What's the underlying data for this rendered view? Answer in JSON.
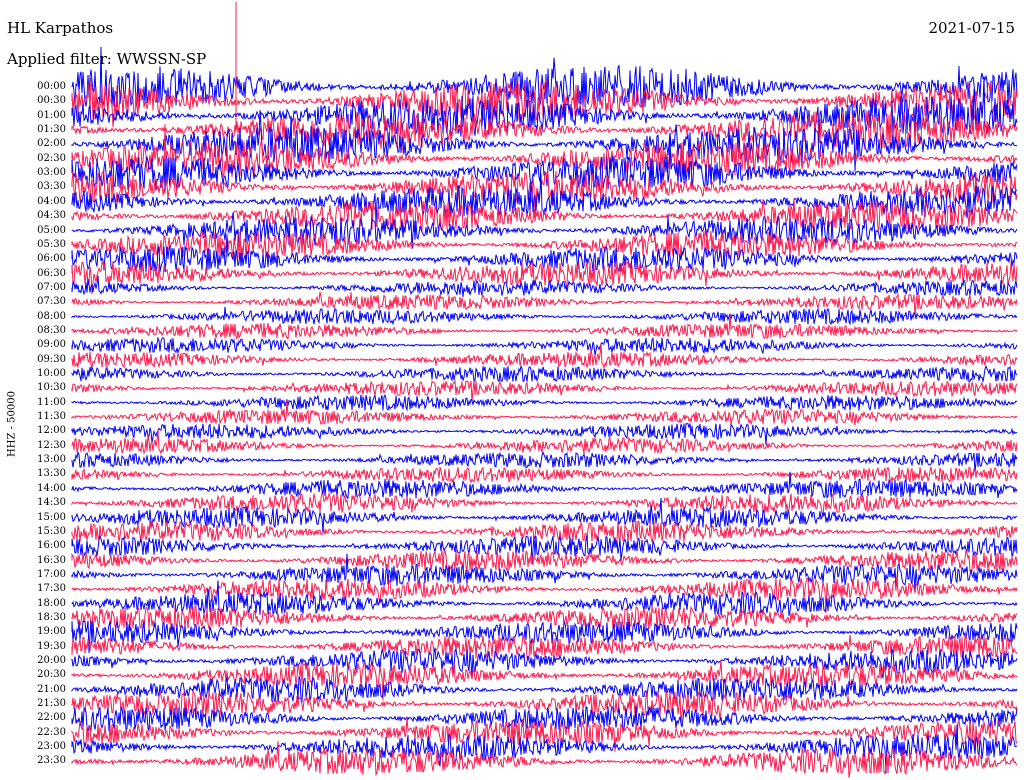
{
  "header": {
    "station": "HL Karpathos",
    "date": "2021-07-15",
    "filter": "Applied filter: WWSSN-SP"
  },
  "axis": {
    "channel_label": "HHZ - 50000"
  },
  "rows": [
    "00:00",
    "00:30",
    "01:00",
    "01:30",
    "02:00",
    "02:30",
    "03:00",
    "03:30",
    "04:00",
    "04:30",
    "05:00",
    "05:30",
    "06:00",
    "06:30",
    "07:00",
    "07:30",
    "08:00",
    "08:30",
    "09:00",
    "09:30",
    "10:00",
    "10:30",
    "11:00",
    "11:30",
    "12:00",
    "12:30",
    "13:00",
    "13:30",
    "14:00",
    "14:30",
    "15:00",
    "15:30",
    "16:00",
    "16:30",
    "17:00",
    "17:30",
    "18:00",
    "18:30",
    "19:00",
    "19:30",
    "20:00",
    "20:30",
    "21:00",
    "21:30",
    "22:00",
    "22:30",
    "23:00",
    "23:30"
  ],
  "colors": {
    "trace_a": "#0000ff",
    "trace_b": "#ff1a4d",
    "text": "#000000",
    "background": "#ffffff"
  }
}
